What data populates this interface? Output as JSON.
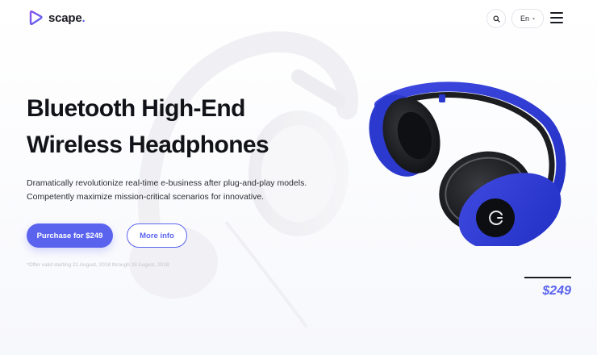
{
  "brand": {
    "name": "scape",
    "dot": ".",
    "accent": "#5a63ee"
  },
  "header": {
    "search_icon": "search-icon",
    "language": "En",
    "language_caret": "▾",
    "menu_icon": "hamburger-icon"
  },
  "hero": {
    "title_lines": [
      "Bluetooth High-End",
      "Wireless Headphones"
    ],
    "description_lines": [
      "Dramatically revolutionize real-time e-business after plug-and-play models.",
      "Competently maximize mission-critical scenarios for innovative."
    ],
    "primary_button": "Purchase for $249",
    "secondary_button": "More info",
    "offer_note": "*Offer valid starting 21 August, 2018 through 28 August, 2018"
  },
  "product": {
    "image": "blue-headphones",
    "price": "$249"
  }
}
